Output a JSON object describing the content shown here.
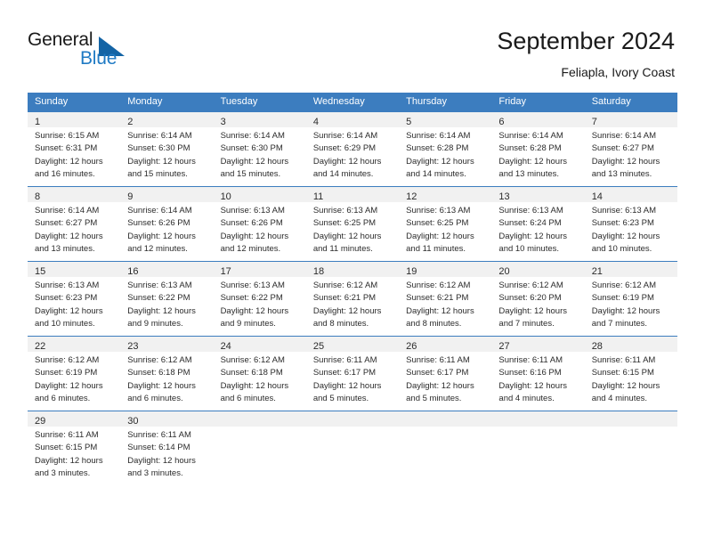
{
  "brand": {
    "name_part1": "General",
    "name_part2": "Blue",
    "triangle_icon": "triangle-icon",
    "color_primary": "#1464a5",
    "color_text": "#1a1a1a"
  },
  "header": {
    "title": "September 2024",
    "subtitle": "Feliapla, Ivory Coast"
  },
  "colors": {
    "header_row_bg": "#3c7dbf",
    "daynum_band_bg": "#f1f1f1",
    "grid_line": "#3c7dbf",
    "text": "#2b2b2b"
  },
  "weekdays": [
    "Sunday",
    "Monday",
    "Tuesday",
    "Wednesday",
    "Thursday",
    "Friday",
    "Saturday"
  ],
  "weeks": [
    [
      {
        "day": "1",
        "sunrise": "Sunrise: 6:15 AM",
        "sunset": "Sunset: 6:31 PM",
        "daylight1": "Daylight: 12 hours",
        "daylight2": "and 16 minutes."
      },
      {
        "day": "2",
        "sunrise": "Sunrise: 6:14 AM",
        "sunset": "Sunset: 6:30 PM",
        "daylight1": "Daylight: 12 hours",
        "daylight2": "and 15 minutes."
      },
      {
        "day": "3",
        "sunrise": "Sunrise: 6:14 AM",
        "sunset": "Sunset: 6:30 PM",
        "daylight1": "Daylight: 12 hours",
        "daylight2": "and 15 minutes."
      },
      {
        "day": "4",
        "sunrise": "Sunrise: 6:14 AM",
        "sunset": "Sunset: 6:29 PM",
        "daylight1": "Daylight: 12 hours",
        "daylight2": "and 14 minutes."
      },
      {
        "day": "5",
        "sunrise": "Sunrise: 6:14 AM",
        "sunset": "Sunset: 6:28 PM",
        "daylight1": "Daylight: 12 hours",
        "daylight2": "and 14 minutes."
      },
      {
        "day": "6",
        "sunrise": "Sunrise: 6:14 AM",
        "sunset": "Sunset: 6:28 PM",
        "daylight1": "Daylight: 12 hours",
        "daylight2": "and 13 minutes."
      },
      {
        "day": "7",
        "sunrise": "Sunrise: 6:14 AM",
        "sunset": "Sunset: 6:27 PM",
        "daylight1": "Daylight: 12 hours",
        "daylight2": "and 13 minutes."
      }
    ],
    [
      {
        "day": "8",
        "sunrise": "Sunrise: 6:14 AM",
        "sunset": "Sunset: 6:27 PM",
        "daylight1": "Daylight: 12 hours",
        "daylight2": "and 13 minutes."
      },
      {
        "day": "9",
        "sunrise": "Sunrise: 6:14 AM",
        "sunset": "Sunset: 6:26 PM",
        "daylight1": "Daylight: 12 hours",
        "daylight2": "and 12 minutes."
      },
      {
        "day": "10",
        "sunrise": "Sunrise: 6:13 AM",
        "sunset": "Sunset: 6:26 PM",
        "daylight1": "Daylight: 12 hours",
        "daylight2": "and 12 minutes."
      },
      {
        "day": "11",
        "sunrise": "Sunrise: 6:13 AM",
        "sunset": "Sunset: 6:25 PM",
        "daylight1": "Daylight: 12 hours",
        "daylight2": "and 11 minutes."
      },
      {
        "day": "12",
        "sunrise": "Sunrise: 6:13 AM",
        "sunset": "Sunset: 6:25 PM",
        "daylight1": "Daylight: 12 hours",
        "daylight2": "and 11 minutes."
      },
      {
        "day": "13",
        "sunrise": "Sunrise: 6:13 AM",
        "sunset": "Sunset: 6:24 PM",
        "daylight1": "Daylight: 12 hours",
        "daylight2": "and 10 minutes."
      },
      {
        "day": "14",
        "sunrise": "Sunrise: 6:13 AM",
        "sunset": "Sunset: 6:23 PM",
        "daylight1": "Daylight: 12 hours",
        "daylight2": "and 10 minutes."
      }
    ],
    [
      {
        "day": "15",
        "sunrise": "Sunrise: 6:13 AM",
        "sunset": "Sunset: 6:23 PM",
        "daylight1": "Daylight: 12 hours",
        "daylight2": "and 10 minutes."
      },
      {
        "day": "16",
        "sunrise": "Sunrise: 6:13 AM",
        "sunset": "Sunset: 6:22 PM",
        "daylight1": "Daylight: 12 hours",
        "daylight2": "and 9 minutes."
      },
      {
        "day": "17",
        "sunrise": "Sunrise: 6:13 AM",
        "sunset": "Sunset: 6:22 PM",
        "daylight1": "Daylight: 12 hours",
        "daylight2": "and 9 minutes."
      },
      {
        "day": "18",
        "sunrise": "Sunrise: 6:12 AM",
        "sunset": "Sunset: 6:21 PM",
        "daylight1": "Daylight: 12 hours",
        "daylight2": "and 8 minutes."
      },
      {
        "day": "19",
        "sunrise": "Sunrise: 6:12 AM",
        "sunset": "Sunset: 6:21 PM",
        "daylight1": "Daylight: 12 hours",
        "daylight2": "and 8 minutes."
      },
      {
        "day": "20",
        "sunrise": "Sunrise: 6:12 AM",
        "sunset": "Sunset: 6:20 PM",
        "daylight1": "Daylight: 12 hours",
        "daylight2": "and 7 minutes."
      },
      {
        "day": "21",
        "sunrise": "Sunrise: 6:12 AM",
        "sunset": "Sunset: 6:19 PM",
        "daylight1": "Daylight: 12 hours",
        "daylight2": "and 7 minutes."
      }
    ],
    [
      {
        "day": "22",
        "sunrise": "Sunrise: 6:12 AM",
        "sunset": "Sunset: 6:19 PM",
        "daylight1": "Daylight: 12 hours",
        "daylight2": "and 6 minutes."
      },
      {
        "day": "23",
        "sunrise": "Sunrise: 6:12 AM",
        "sunset": "Sunset: 6:18 PM",
        "daylight1": "Daylight: 12 hours",
        "daylight2": "and 6 minutes."
      },
      {
        "day": "24",
        "sunrise": "Sunrise: 6:12 AM",
        "sunset": "Sunset: 6:18 PM",
        "daylight1": "Daylight: 12 hours",
        "daylight2": "and 6 minutes."
      },
      {
        "day": "25",
        "sunrise": "Sunrise: 6:11 AM",
        "sunset": "Sunset: 6:17 PM",
        "daylight1": "Daylight: 12 hours",
        "daylight2": "and 5 minutes."
      },
      {
        "day": "26",
        "sunrise": "Sunrise: 6:11 AM",
        "sunset": "Sunset: 6:17 PM",
        "daylight1": "Daylight: 12 hours",
        "daylight2": "and 5 minutes."
      },
      {
        "day": "27",
        "sunrise": "Sunrise: 6:11 AM",
        "sunset": "Sunset: 6:16 PM",
        "daylight1": "Daylight: 12 hours",
        "daylight2": "and 4 minutes."
      },
      {
        "day": "28",
        "sunrise": "Sunrise: 6:11 AM",
        "sunset": "Sunset: 6:15 PM",
        "daylight1": "Daylight: 12 hours",
        "daylight2": "and 4 minutes."
      }
    ],
    [
      {
        "day": "29",
        "sunrise": "Sunrise: 6:11 AM",
        "sunset": "Sunset: 6:15 PM",
        "daylight1": "Daylight: 12 hours",
        "daylight2": "and 3 minutes."
      },
      {
        "day": "30",
        "sunrise": "Sunrise: 6:11 AM",
        "sunset": "Sunset: 6:14 PM",
        "daylight1": "Daylight: 12 hours",
        "daylight2": "and 3 minutes."
      },
      {
        "day": "",
        "sunrise": "",
        "sunset": "",
        "daylight1": "",
        "daylight2": ""
      },
      {
        "day": "",
        "sunrise": "",
        "sunset": "",
        "daylight1": "",
        "daylight2": ""
      },
      {
        "day": "",
        "sunrise": "",
        "sunset": "",
        "daylight1": "",
        "daylight2": ""
      },
      {
        "day": "",
        "sunrise": "",
        "sunset": "",
        "daylight1": "",
        "daylight2": ""
      },
      {
        "day": "",
        "sunrise": "",
        "sunset": "",
        "daylight1": "",
        "daylight2": ""
      }
    ]
  ]
}
